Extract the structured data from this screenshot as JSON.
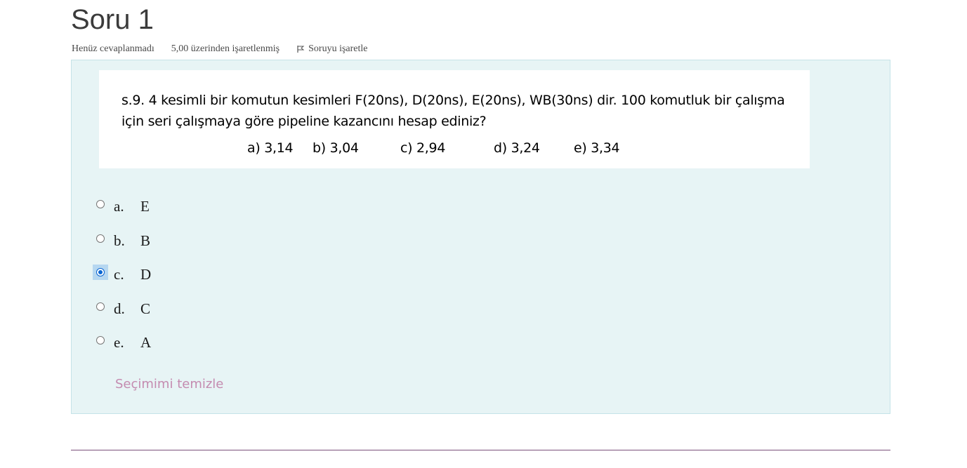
{
  "question": {
    "title": "Soru 1",
    "status": "Henüz cevaplanmadı",
    "marks": "5,00 üzerinden işaretlenmiş",
    "flag_label": "Soruyu işaretle"
  },
  "image": {
    "stem": "s.9. 4 kesimli bir komutun kesimleri F(20ns), D(20ns), E(20ns), WB(30ns) dir. 100 komutluk bir çalışma için seri çalışmaya göre pipeline kazancını hesap ediniz?",
    "choices": [
      "a) 3,14",
      "b) 3,04",
      "c) 2,94",
      "d) 3,24",
      "e) 3,34"
    ]
  },
  "answers": [
    {
      "letter": "a.",
      "text": "E",
      "checked": false
    },
    {
      "letter": "b.",
      "text": "B",
      "checked": false
    },
    {
      "letter": "c.",
      "text": "D",
      "checked": true
    },
    {
      "letter": "d.",
      "text": "C",
      "checked": false
    },
    {
      "letter": "e.",
      "text": "A",
      "checked": false
    }
  ],
  "clear_choice_label": "Seçimimi temizle",
  "colors": {
    "box_bg": "#e7f4f5",
    "box_border": "#c5e3e8",
    "link": "#c48bb0",
    "radio_selected": "#0a66d2",
    "rule": "#7a4f7a"
  }
}
